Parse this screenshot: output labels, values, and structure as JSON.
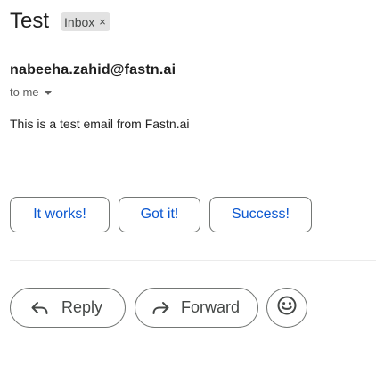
{
  "email": {
    "subject": "Test",
    "label": "Inbox",
    "label_remove_glyph": "×",
    "sender": "nabeeha.zahid@fastn.ai",
    "recipient": "to me",
    "body": "This is a test email from Fastn.ai"
  },
  "smart_replies": [
    "It works!",
    "Got it!",
    "Success!"
  ],
  "actions": {
    "reply_label": "Reply",
    "reply_icon": "reply-arrow-icon",
    "forward_label": "Forward",
    "forward_icon": "forward-arrow-icon",
    "emoji_icon": "smiley-face-icon"
  },
  "colors": {
    "accent": "#0b57d0",
    "chip_bg": "#e2e2e2",
    "border": "#747775",
    "text": "#1f1f1f",
    "muted": "#444746"
  }
}
